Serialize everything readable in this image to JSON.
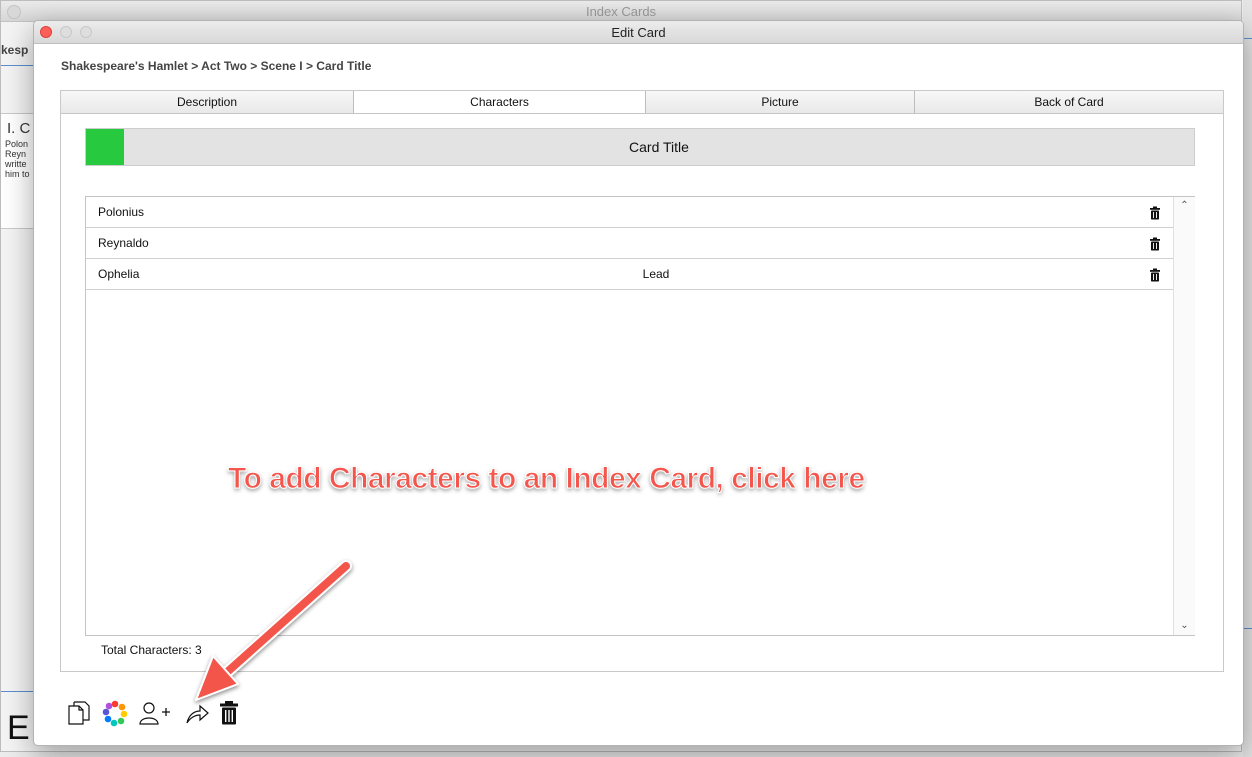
{
  "background_window": {
    "title": "Index Cards",
    "left_tab_text": "kesp",
    "left_card": {
      "heading": "I. C",
      "lines": [
        "Polon",
        "Reyn",
        "writte",
        "him to"
      ]
    },
    "bottom_letter": "E"
  },
  "window": {
    "title": "Edit Card"
  },
  "breadcrumb": "Shakespeare's Hamlet > Act Two > Scene I > Card Title",
  "tabs": [
    {
      "label": "Description",
      "active": false
    },
    {
      "label": "Characters",
      "active": true
    },
    {
      "label": "Picture",
      "active": false
    },
    {
      "label": "Back of Card",
      "active": false
    }
  ],
  "card": {
    "title": "Card Title",
    "color": "#27c93f"
  },
  "characters": [
    {
      "name": "Polonius",
      "role": ""
    },
    {
      "name": "Reynaldo",
      "role": ""
    },
    {
      "name": "Ophelia",
      "role": "Lead"
    }
  ],
  "total_characters": "Total Characters: 3",
  "toolbar": {
    "icons": [
      "copy-card-icon",
      "color-wheel-icon",
      "add-character-icon",
      "share-icon",
      "trash-icon"
    ]
  },
  "annotation": {
    "text": "To add Characters to an Index Card, click here",
    "color": "#f4554c"
  }
}
